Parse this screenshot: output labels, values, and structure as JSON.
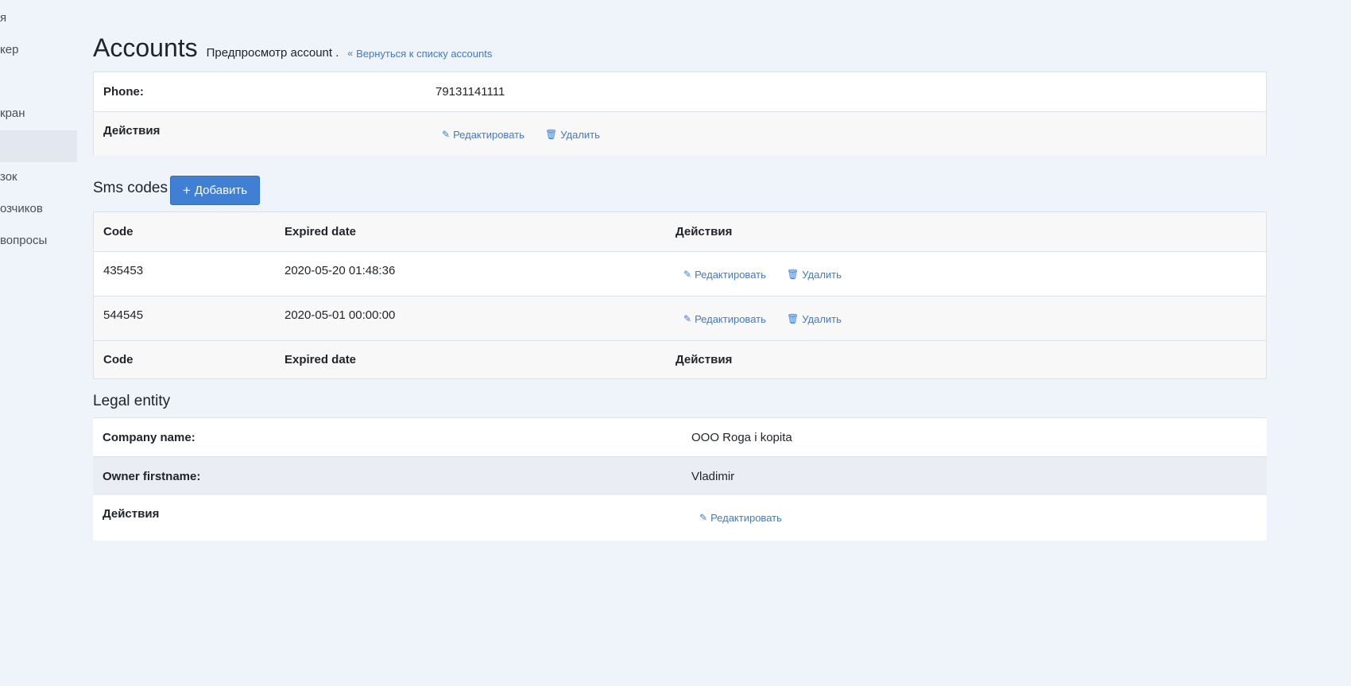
{
  "sidebar": {
    "items": [
      {
        "label": "я"
      },
      {
        "label": "кер"
      },
      {
        "label": ""
      },
      {
        "label": "кран"
      },
      {
        "label": ""
      },
      {
        "label": "зок"
      },
      {
        "label": "озчиков"
      },
      {
        "label": "вопросы"
      }
    ]
  },
  "header": {
    "title": "Accounts",
    "subtitle": "Предпросмотр account .",
    "back_link": "Вернуться к списку accounts"
  },
  "account": {
    "phone_label": "Phone:",
    "phone_value": "79131141111",
    "actions_label": "Действия",
    "edit_label": "Редактировать",
    "delete_label": "Удалить"
  },
  "sms_codes": {
    "title": "Sms codes",
    "add_label": "Добавить",
    "columns": [
      "Code",
      "Expired date",
      "Действия"
    ],
    "rows": [
      {
        "code": "435453",
        "expired": "2020-05-20 01:48:36",
        "edit": "Редактировать",
        "delete": "Удалить"
      },
      {
        "code": "544545",
        "expired": "2020-05-01 00:00:00",
        "edit": "Редактировать",
        "delete": "Удалить"
      }
    ]
  },
  "legal_entity": {
    "title": "Legal entity",
    "company_label": "Company name:",
    "company_value": "OOO Roga i kopita",
    "owner_label": "Owner firstname:",
    "owner_value": "Vladimir",
    "actions_label": "Действия",
    "edit_label": "Редактировать"
  },
  "colors": {
    "background": "#eff3fa",
    "link": "#3a7bd5",
    "primary_button": "#3f7fd4"
  }
}
